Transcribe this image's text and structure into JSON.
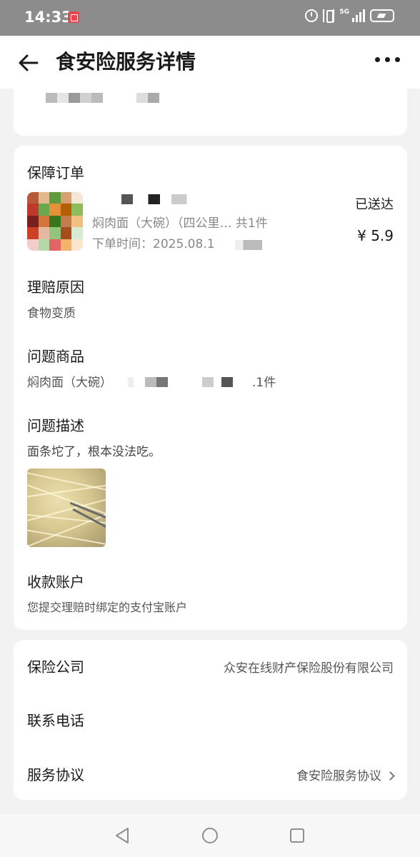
{
  "status_bar": {
    "time": "14:33",
    "network": "5G"
  },
  "header": {
    "title": "食安险服务详情"
  },
  "order": {
    "section_title": "保障订单",
    "item_name": "焖肉面（大碗）（四公里… 共1件",
    "order_time_prefix": "下单时间：2025.08.1",
    "status": "已送达",
    "price": "¥ 5.9"
  },
  "claim_reason": {
    "title": "理赔原因",
    "value": "食物变质"
  },
  "problem_item": {
    "title": "问题商品",
    "name_prefix": "焖肉面（大碗）",
    "qty_suffix": ".1件"
  },
  "problem_desc": {
    "title": "问题描述",
    "value": "面条坨了，根本没法吃。"
  },
  "payee": {
    "title": "收款账户",
    "value": "您提交理赔时绑定的支付宝账户"
  },
  "info": {
    "insurer_label": "保险公司",
    "insurer_value": "众安在线财产保险股份有限公司",
    "phone_label": "联系电话",
    "agreement_label": "服务协议",
    "agreement_value": "食安险服务协议"
  },
  "colors": {
    "page_bg": "#f2f2f2",
    "card_bg": "#ffffff",
    "status_bar": "#8c8c8c",
    "secondary_text": "#888888"
  }
}
